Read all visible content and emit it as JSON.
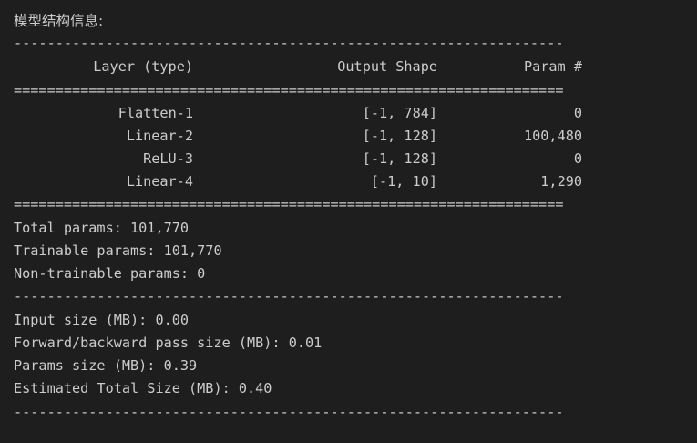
{
  "title": "模型结构信息:",
  "separator_dash": "------------------------------------------------------------------",
  "separator_equal": "==================================================================",
  "table": {
    "headers": {
      "layer": "Layer (type)",
      "output_shape": "Output Shape",
      "param": "Param #"
    },
    "rows": [
      {
        "layer": "Flatten-1",
        "output_shape": "[-1, 784]",
        "param": "0"
      },
      {
        "layer": "Linear-2",
        "output_shape": "[-1, 128]",
        "param": "100,480"
      },
      {
        "layer": "ReLU-3",
        "output_shape": "[-1, 128]",
        "param": "0"
      },
      {
        "layer": "Linear-4",
        "output_shape": "[-1, 10]",
        "param": "1,290"
      }
    ]
  },
  "params_summary": {
    "total": "Total params: 101,770",
    "trainable": "Trainable params: 101,770",
    "non_trainable": "Non-trainable params: 0"
  },
  "size_summary": {
    "input": "Input size (MB): 0.00",
    "forward_backward": "Forward/backward pass size (MB): 0.01",
    "params": "Params size (MB): 0.39",
    "estimated_total": "Estimated Total Size (MB): 0.40"
  }
}
